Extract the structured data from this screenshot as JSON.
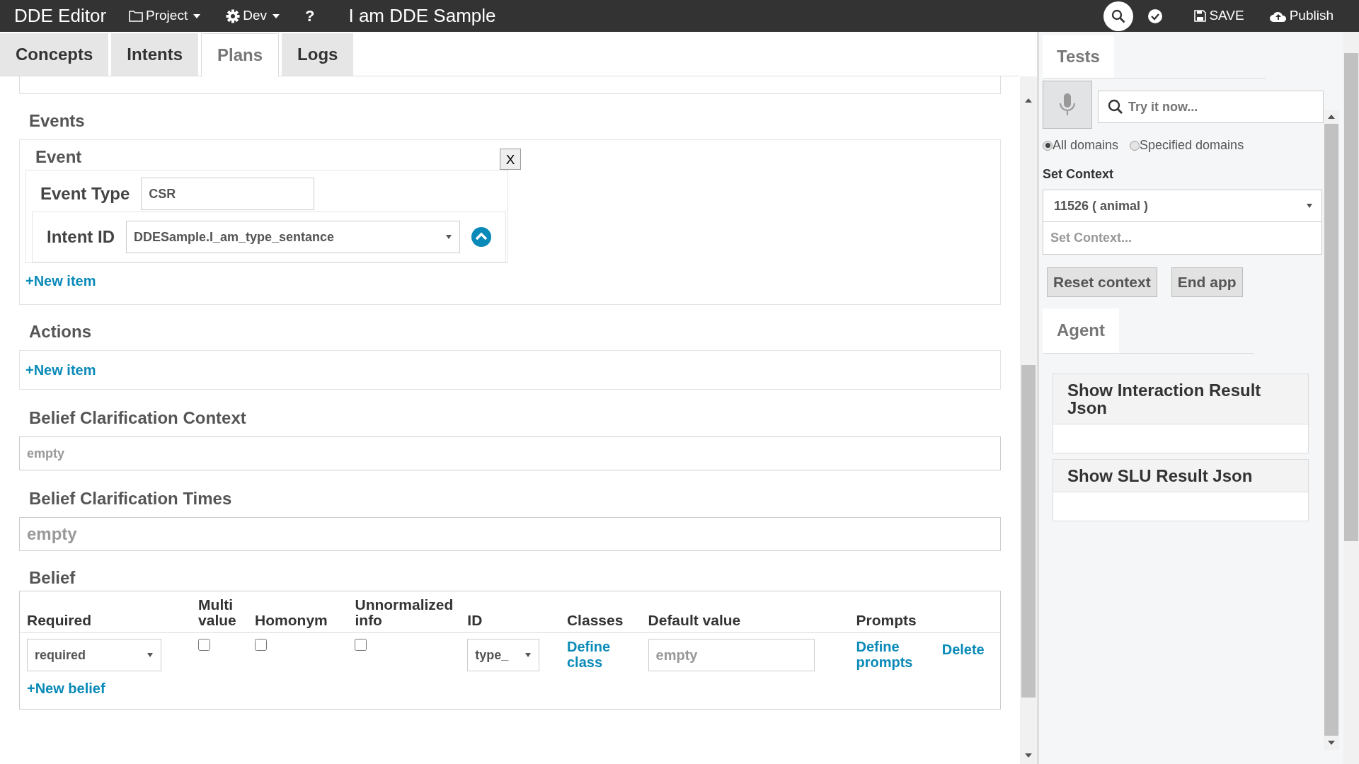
{
  "navbar": {
    "brand": "DDE Editor",
    "menus": [
      {
        "label": "Project"
      },
      {
        "label": "Dev"
      }
    ],
    "help": "?",
    "project_title": "I am DDE Sample",
    "actions": [
      {
        "label": "SAVE"
      },
      {
        "label": "Publish"
      }
    ]
  },
  "tabs": [
    {
      "label": "Concepts",
      "selected": false
    },
    {
      "label": "Intents",
      "selected": false
    },
    {
      "label": "Plans",
      "selected": true
    },
    {
      "label": "Logs",
      "selected": false
    }
  ],
  "events": {
    "title": "Events",
    "event_title": "Event",
    "close": "X",
    "event_type_label": "Event Type",
    "event_type_value": "CSR",
    "intent_label": "Intent ID",
    "intent_value": "DDESample.I_am_type_sentance",
    "new_item": "+New item"
  },
  "actions": {
    "title": "Actions",
    "new_item": "+New item"
  },
  "belief_context": {
    "title": "Belief Clarification Context",
    "placeholder": "empty"
  },
  "belief_times": {
    "title": "Belief Clarification Times",
    "placeholder": "empty"
  },
  "belief": {
    "title": "Belief",
    "columns": [
      "Required",
      "Multi value",
      "Homonym",
      "Unnormalized info",
      "ID",
      "Classes",
      "Default value",
      "Prompts"
    ],
    "rows": [
      {
        "required": "required",
        "multi_value": false,
        "homonym": false,
        "unnormalized_info": false,
        "id": "type_",
        "classes": "Define class",
        "default_placeholder": "empty",
        "prompts": "Define prompts",
        "delete": "Delete"
      }
    ],
    "new_belief": "+New belief"
  },
  "tests": {
    "tabs": [
      {
        "label": "Tests",
        "selected": true
      }
    ],
    "search_placeholder": "Try it now...",
    "domains": [
      {
        "label": "All domains",
        "selected": true
      },
      {
        "label": "Specified domains",
        "selected": false
      }
    ],
    "set_context_label": "Set Context",
    "context_value": "11526 ( animal )",
    "context_placeholder": "Set Context...",
    "buttons": [
      "Reset context",
      "End app"
    ],
    "agent_tabs": [
      {
        "label": "Agent",
        "selected": true
      }
    ],
    "panels": [
      "Show Interaction Result Json",
      "Show SLU Result Json"
    ]
  }
}
